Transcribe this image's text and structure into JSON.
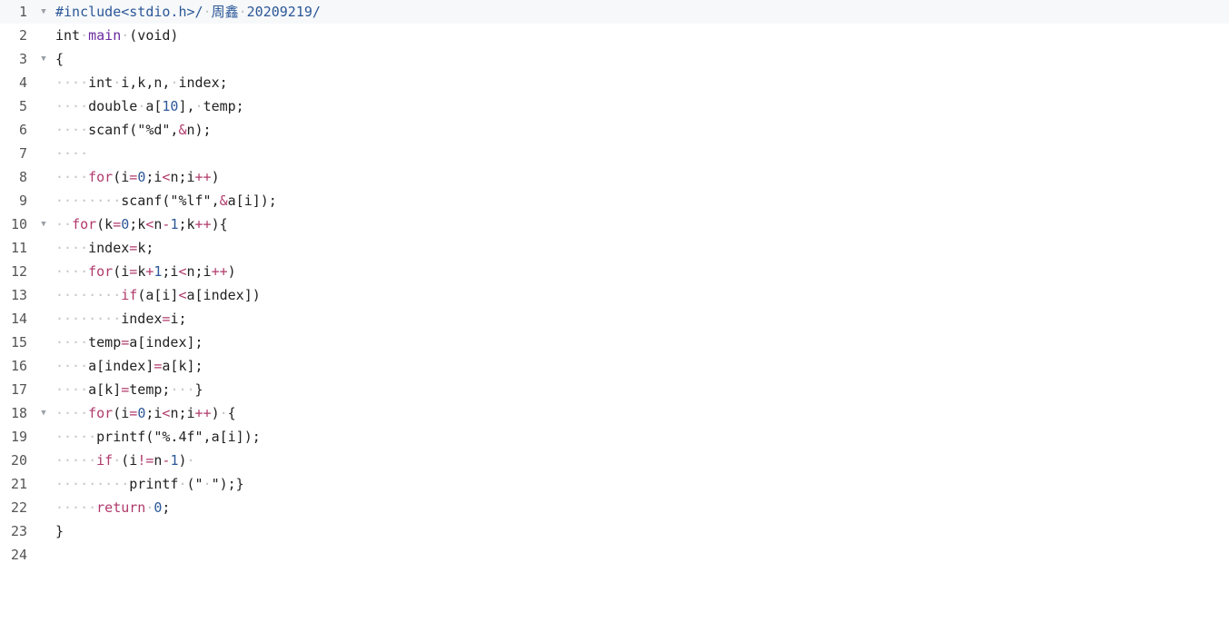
{
  "editor": {
    "lines": [
      {
        "n": "1",
        "fold": true,
        "active": true,
        "tokens": [
          {
            "t": "pp",
            "v": "#include<stdio.h>/"
          },
          {
            "t": "ws",
            "v": "·"
          },
          {
            "t": "pp",
            "v": "周鑫"
          },
          {
            "t": "ws",
            "v": "·"
          },
          {
            "t": "pp",
            "v": "20209219/"
          }
        ]
      },
      {
        "n": "2",
        "fold": false,
        "tokens": [
          {
            "t": "",
            "v": "int"
          },
          {
            "t": "ws",
            "v": "·"
          },
          {
            "t": "fn",
            "v": "main"
          },
          {
            "t": "ws",
            "v": "·"
          },
          {
            "t": "",
            "v": "(void)"
          }
        ]
      },
      {
        "n": "3",
        "fold": true,
        "tokens": [
          {
            "t": "",
            "v": "{"
          }
        ]
      },
      {
        "n": "4",
        "fold": false,
        "tokens": [
          {
            "t": "ws",
            "v": "····"
          },
          {
            "t": "",
            "v": "int"
          },
          {
            "t": "ws",
            "v": "·"
          },
          {
            "t": "",
            "v": "i,k,n,"
          },
          {
            "t": "ws",
            "v": "·"
          },
          {
            "t": "",
            "v": "index;"
          }
        ]
      },
      {
        "n": "5",
        "fold": false,
        "tokens": [
          {
            "t": "ws",
            "v": "····"
          },
          {
            "t": "",
            "v": "double"
          },
          {
            "t": "ws",
            "v": "·"
          },
          {
            "t": "",
            "v": "a["
          },
          {
            "t": "num",
            "v": "10"
          },
          {
            "t": "",
            "v": "],"
          },
          {
            "t": "ws",
            "v": "·"
          },
          {
            "t": "",
            "v": "temp;"
          }
        ]
      },
      {
        "n": "6",
        "fold": false,
        "tokens": [
          {
            "t": "ws",
            "v": "····"
          },
          {
            "t": "",
            "v": "scanf(\"%d\","
          },
          {
            "t": "op",
            "v": "&"
          },
          {
            "t": "",
            "v": "n);"
          }
        ]
      },
      {
        "n": "7",
        "fold": false,
        "tokens": [
          {
            "t": "ws",
            "v": "····"
          }
        ]
      },
      {
        "n": "8",
        "fold": false,
        "tokens": [
          {
            "t": "ws",
            "v": "····"
          },
          {
            "t": "kw",
            "v": "for"
          },
          {
            "t": "",
            "v": "(i"
          },
          {
            "t": "op",
            "v": "="
          },
          {
            "t": "num",
            "v": "0"
          },
          {
            "t": "",
            "v": ";i"
          },
          {
            "t": "op",
            "v": "<"
          },
          {
            "t": "",
            "v": "n;i"
          },
          {
            "t": "op",
            "v": "++"
          },
          {
            "t": "",
            "v": ")"
          }
        ]
      },
      {
        "n": "9",
        "fold": false,
        "tokens": [
          {
            "t": "ws",
            "v": "········"
          },
          {
            "t": "",
            "v": "scanf(\"%lf\","
          },
          {
            "t": "op",
            "v": "&"
          },
          {
            "t": "",
            "v": "a[i]);"
          }
        ]
      },
      {
        "n": "10",
        "fold": true,
        "tokens": [
          {
            "t": "ws",
            "v": "··"
          },
          {
            "t": "kw",
            "v": "for"
          },
          {
            "t": "",
            "v": "(k"
          },
          {
            "t": "op",
            "v": "="
          },
          {
            "t": "num",
            "v": "0"
          },
          {
            "t": "",
            "v": ";k"
          },
          {
            "t": "op",
            "v": "<"
          },
          {
            "t": "",
            "v": "n"
          },
          {
            "t": "op",
            "v": "-"
          },
          {
            "t": "num",
            "v": "1"
          },
          {
            "t": "",
            "v": ";k"
          },
          {
            "t": "op",
            "v": "++"
          },
          {
            "t": "",
            "v": "){"
          }
        ]
      },
      {
        "n": "11",
        "fold": false,
        "tokens": [
          {
            "t": "ws",
            "v": "····"
          },
          {
            "t": "",
            "v": "index"
          },
          {
            "t": "op",
            "v": "="
          },
          {
            "t": "",
            "v": "k;"
          }
        ]
      },
      {
        "n": "12",
        "fold": false,
        "tokens": [
          {
            "t": "ws",
            "v": "····"
          },
          {
            "t": "kw",
            "v": "for"
          },
          {
            "t": "",
            "v": "(i"
          },
          {
            "t": "op",
            "v": "="
          },
          {
            "t": "",
            "v": "k"
          },
          {
            "t": "op",
            "v": "+"
          },
          {
            "t": "num",
            "v": "1"
          },
          {
            "t": "",
            "v": ";i"
          },
          {
            "t": "op",
            "v": "<"
          },
          {
            "t": "",
            "v": "n;i"
          },
          {
            "t": "op",
            "v": "++"
          },
          {
            "t": "",
            "v": ")"
          }
        ]
      },
      {
        "n": "13",
        "fold": false,
        "tokens": [
          {
            "t": "ws",
            "v": "········"
          },
          {
            "t": "kw",
            "v": "if"
          },
          {
            "t": "",
            "v": "(a[i]"
          },
          {
            "t": "op",
            "v": "<"
          },
          {
            "t": "",
            "v": "a[index])"
          }
        ]
      },
      {
        "n": "14",
        "fold": false,
        "tokens": [
          {
            "t": "ws",
            "v": "········"
          },
          {
            "t": "",
            "v": "index"
          },
          {
            "t": "op",
            "v": "="
          },
          {
            "t": "",
            "v": "i;"
          }
        ]
      },
      {
        "n": "15",
        "fold": false,
        "tokens": [
          {
            "t": "ws",
            "v": "····"
          },
          {
            "t": "",
            "v": "temp"
          },
          {
            "t": "op",
            "v": "="
          },
          {
            "t": "",
            "v": "a[index];"
          }
        ]
      },
      {
        "n": "16",
        "fold": false,
        "tokens": [
          {
            "t": "ws",
            "v": "····"
          },
          {
            "t": "",
            "v": "a[index]"
          },
          {
            "t": "op",
            "v": "="
          },
          {
            "t": "",
            "v": "a[k];"
          }
        ]
      },
      {
        "n": "17",
        "fold": false,
        "tokens": [
          {
            "t": "ws",
            "v": "····"
          },
          {
            "t": "",
            "v": "a[k]"
          },
          {
            "t": "op",
            "v": "="
          },
          {
            "t": "",
            "v": "temp;"
          },
          {
            "t": "ws",
            "v": "···"
          },
          {
            "t": "",
            "v": "}"
          }
        ]
      },
      {
        "n": "18",
        "fold": true,
        "tokens": [
          {
            "t": "ws",
            "v": "····"
          },
          {
            "t": "kw",
            "v": "for"
          },
          {
            "t": "",
            "v": "(i"
          },
          {
            "t": "op",
            "v": "="
          },
          {
            "t": "num",
            "v": "0"
          },
          {
            "t": "",
            "v": ";i"
          },
          {
            "t": "op",
            "v": "<"
          },
          {
            "t": "",
            "v": "n;i"
          },
          {
            "t": "op",
            "v": "++"
          },
          {
            "t": "",
            "v": ")"
          },
          {
            "t": "ws",
            "v": "·"
          },
          {
            "t": "",
            "v": "{"
          }
        ]
      },
      {
        "n": "19",
        "fold": false,
        "tokens": [
          {
            "t": "ws",
            "v": "·····"
          },
          {
            "t": "",
            "v": "printf(\"%.4f\",a[i]);"
          }
        ]
      },
      {
        "n": "20",
        "fold": false,
        "tokens": [
          {
            "t": "ws",
            "v": "·····"
          },
          {
            "t": "kw",
            "v": "if"
          },
          {
            "t": "ws",
            "v": "·"
          },
          {
            "t": "",
            "v": "(i"
          },
          {
            "t": "op",
            "v": "!="
          },
          {
            "t": "",
            "v": "n"
          },
          {
            "t": "op",
            "v": "-"
          },
          {
            "t": "num",
            "v": "1"
          },
          {
            "t": "",
            "v": ")"
          },
          {
            "t": "ws",
            "v": "·"
          }
        ]
      },
      {
        "n": "21",
        "fold": false,
        "tokens": [
          {
            "t": "ws",
            "v": "·········"
          },
          {
            "t": "",
            "v": "printf"
          },
          {
            "t": "ws",
            "v": "·"
          },
          {
            "t": "",
            "v": "(\""
          },
          {
            "t": "ws",
            "v": "·"
          },
          {
            "t": "",
            "v": "\");}"
          }
        ]
      },
      {
        "n": "22",
        "fold": false,
        "tokens": [
          {
            "t": "ws",
            "v": "·····"
          },
          {
            "t": "kw",
            "v": "return"
          },
          {
            "t": "ws",
            "v": "·"
          },
          {
            "t": "num",
            "v": "0"
          },
          {
            "t": "",
            "v": ";"
          }
        ]
      },
      {
        "n": "23",
        "fold": false,
        "tokens": [
          {
            "t": "",
            "v": "}"
          }
        ]
      },
      {
        "n": "24",
        "fold": false,
        "tokens": []
      }
    ]
  },
  "icons": {
    "fold": "chevron-down-icon"
  },
  "colors": {
    "keyword": "#b03a6b",
    "function": "#6a2aa0",
    "preprocessor": "#2b5797",
    "number": "#2b5797",
    "whitespace": "#c5c5c5",
    "text": "#222222",
    "gutter": "#555555",
    "active_line": "#f6f8fa"
  }
}
